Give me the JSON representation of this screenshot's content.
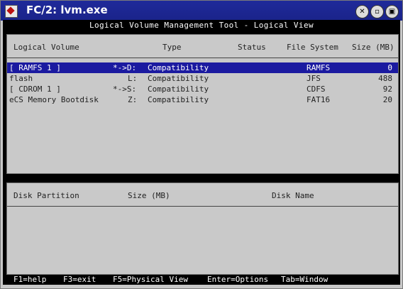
{
  "window": {
    "title": "FC/2: lvm.exe"
  },
  "app": {
    "title": "Logical Volume Management Tool - Logical View"
  },
  "volumes": {
    "headers": {
      "name": "Logical Volume",
      "type": "Type",
      "status": "Status",
      "fs": "File System",
      "size": "Size (MB)"
    },
    "rows": [
      {
        "name": "[ RAMFS 1 ]",
        "drive": "*->D:",
        "type": "Compatibility",
        "status": "",
        "fs": "RAMFS",
        "size": "0"
      },
      {
        "name": "flash",
        "drive": "L:",
        "type": "Compatibility",
        "status": "",
        "fs": "JFS",
        "size": "488"
      },
      {
        "name": "[ CDROM 1 ]",
        "drive": "*->S:",
        "type": "Compatibility",
        "status": "",
        "fs": "CDFS",
        "size": "92"
      },
      {
        "name": "eCS Memory Bootdisk",
        "drive": "Z:",
        "type": "Compatibility",
        "status": "",
        "fs": "FAT16",
        "size": "20"
      }
    ]
  },
  "partitions": {
    "headers": {
      "partition": "Disk Partition",
      "size": "Size (MB)",
      "disk": "Disk Name"
    }
  },
  "statusbar": {
    "help": "F1=help",
    "exit": "F3=exit",
    "physical": "F5=Physical View",
    "options": "Enter=Options",
    "window": "Tab=Window"
  }
}
